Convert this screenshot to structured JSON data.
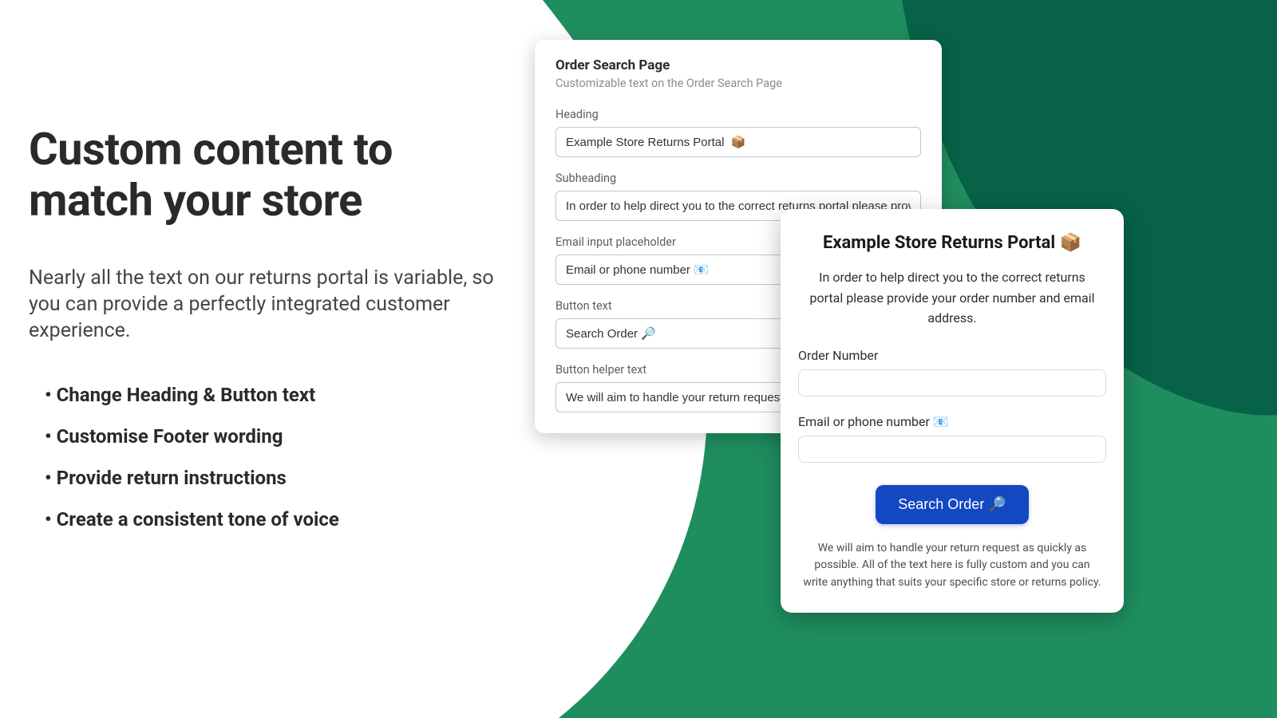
{
  "marketing": {
    "headline": "Custom content to match your store",
    "subheadline": "Nearly all the text on our returns portal is variable, so you can provide a perfectly integrated customer experience.",
    "bullets": [
      "Change Heading & Button text",
      "Customise Footer wording",
      "Provide return instructions",
      "Create a consistent tone of voice"
    ]
  },
  "admin": {
    "title": "Order Search Page",
    "subtitle": "Customizable text on the Order Search Page",
    "fields": {
      "heading_label": "Heading",
      "heading_value": "Example Store Returns Portal  📦",
      "subheading_label": "Subheading",
      "subheading_value": "In order to help direct you to the correct returns portal please provide your order n",
      "email_ph_label": "Email input placeholder",
      "email_ph_value": "Email or phone number 📧",
      "button_text_label": "Button text",
      "button_text_value": "Search Order 🔎",
      "button_helper_label": "Button helper text",
      "button_helper_value": "We will aim to handle your return request as quickl"
    }
  },
  "portal": {
    "title": "Example Store Returns Portal 📦",
    "description": "In order to help direct you to the correct returns portal please provide your order number and email address.",
    "order_label": "Order Number",
    "email_label": "Email or phone number 📧",
    "button": "Search Order 🔎",
    "helper": "We will aim to handle your return request as quickly as possible. All of the text here is fully custom and you can write anything that suits your specific store or returns policy."
  },
  "colors": {
    "green_main": "#1f8e5f",
    "green_dark": "#076248",
    "blue_button": "#1447c2"
  }
}
